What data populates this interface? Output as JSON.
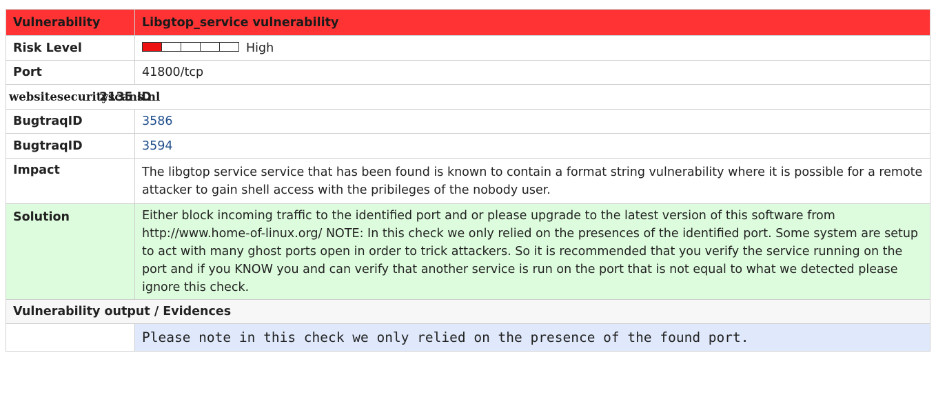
{
  "header": {
    "label": "Vulnerability",
    "title": "Libgtop_service vulnerability",
    "color": "#ff3333"
  },
  "risk": {
    "label": "Risk Level",
    "value_text": "High",
    "meter": {
      "filled": 1,
      "total": 5,
      "fill_color": "#ee1111"
    }
  },
  "port": {
    "label": "Port",
    "value": "41800/tcp"
  },
  "cve_row": {
    "watermark": "websitesecurityscans.nl",
    "text": "2135 ID"
  },
  "bugtraq": [
    {
      "label": "BugtraqID",
      "value": "3586"
    },
    {
      "label": "BugtraqID",
      "value": "3594"
    }
  ],
  "impact": {
    "label": "Impact",
    "text": "The libgtop service service that has been found is known to contain a format string vulnerability where it is possible for a remote attacker to gain shell access with the pribileges of the nobody user."
  },
  "solution": {
    "label": "Solution",
    "text": "Either block incoming traffic to the identified port and or please upgrade to the latest version of this software from http://www.home-of-linux.org/ NOTE: In this check we only relied on the presences of the identified port. Some system are setup to act with many ghost ports open in order to trick attackers. So it is recommended that you verify the service running on the port and if you KNOW you and can verify that another service is run on the port that is not equal to what we detected please ignore this check.",
    "bg_color": "#ddfcdd"
  },
  "evidence": {
    "label": "Vulnerability output / Evidences",
    "output": "Please note in this check we only relied on the presence of the found port.",
    "bg_color": "#dfe9fb"
  }
}
